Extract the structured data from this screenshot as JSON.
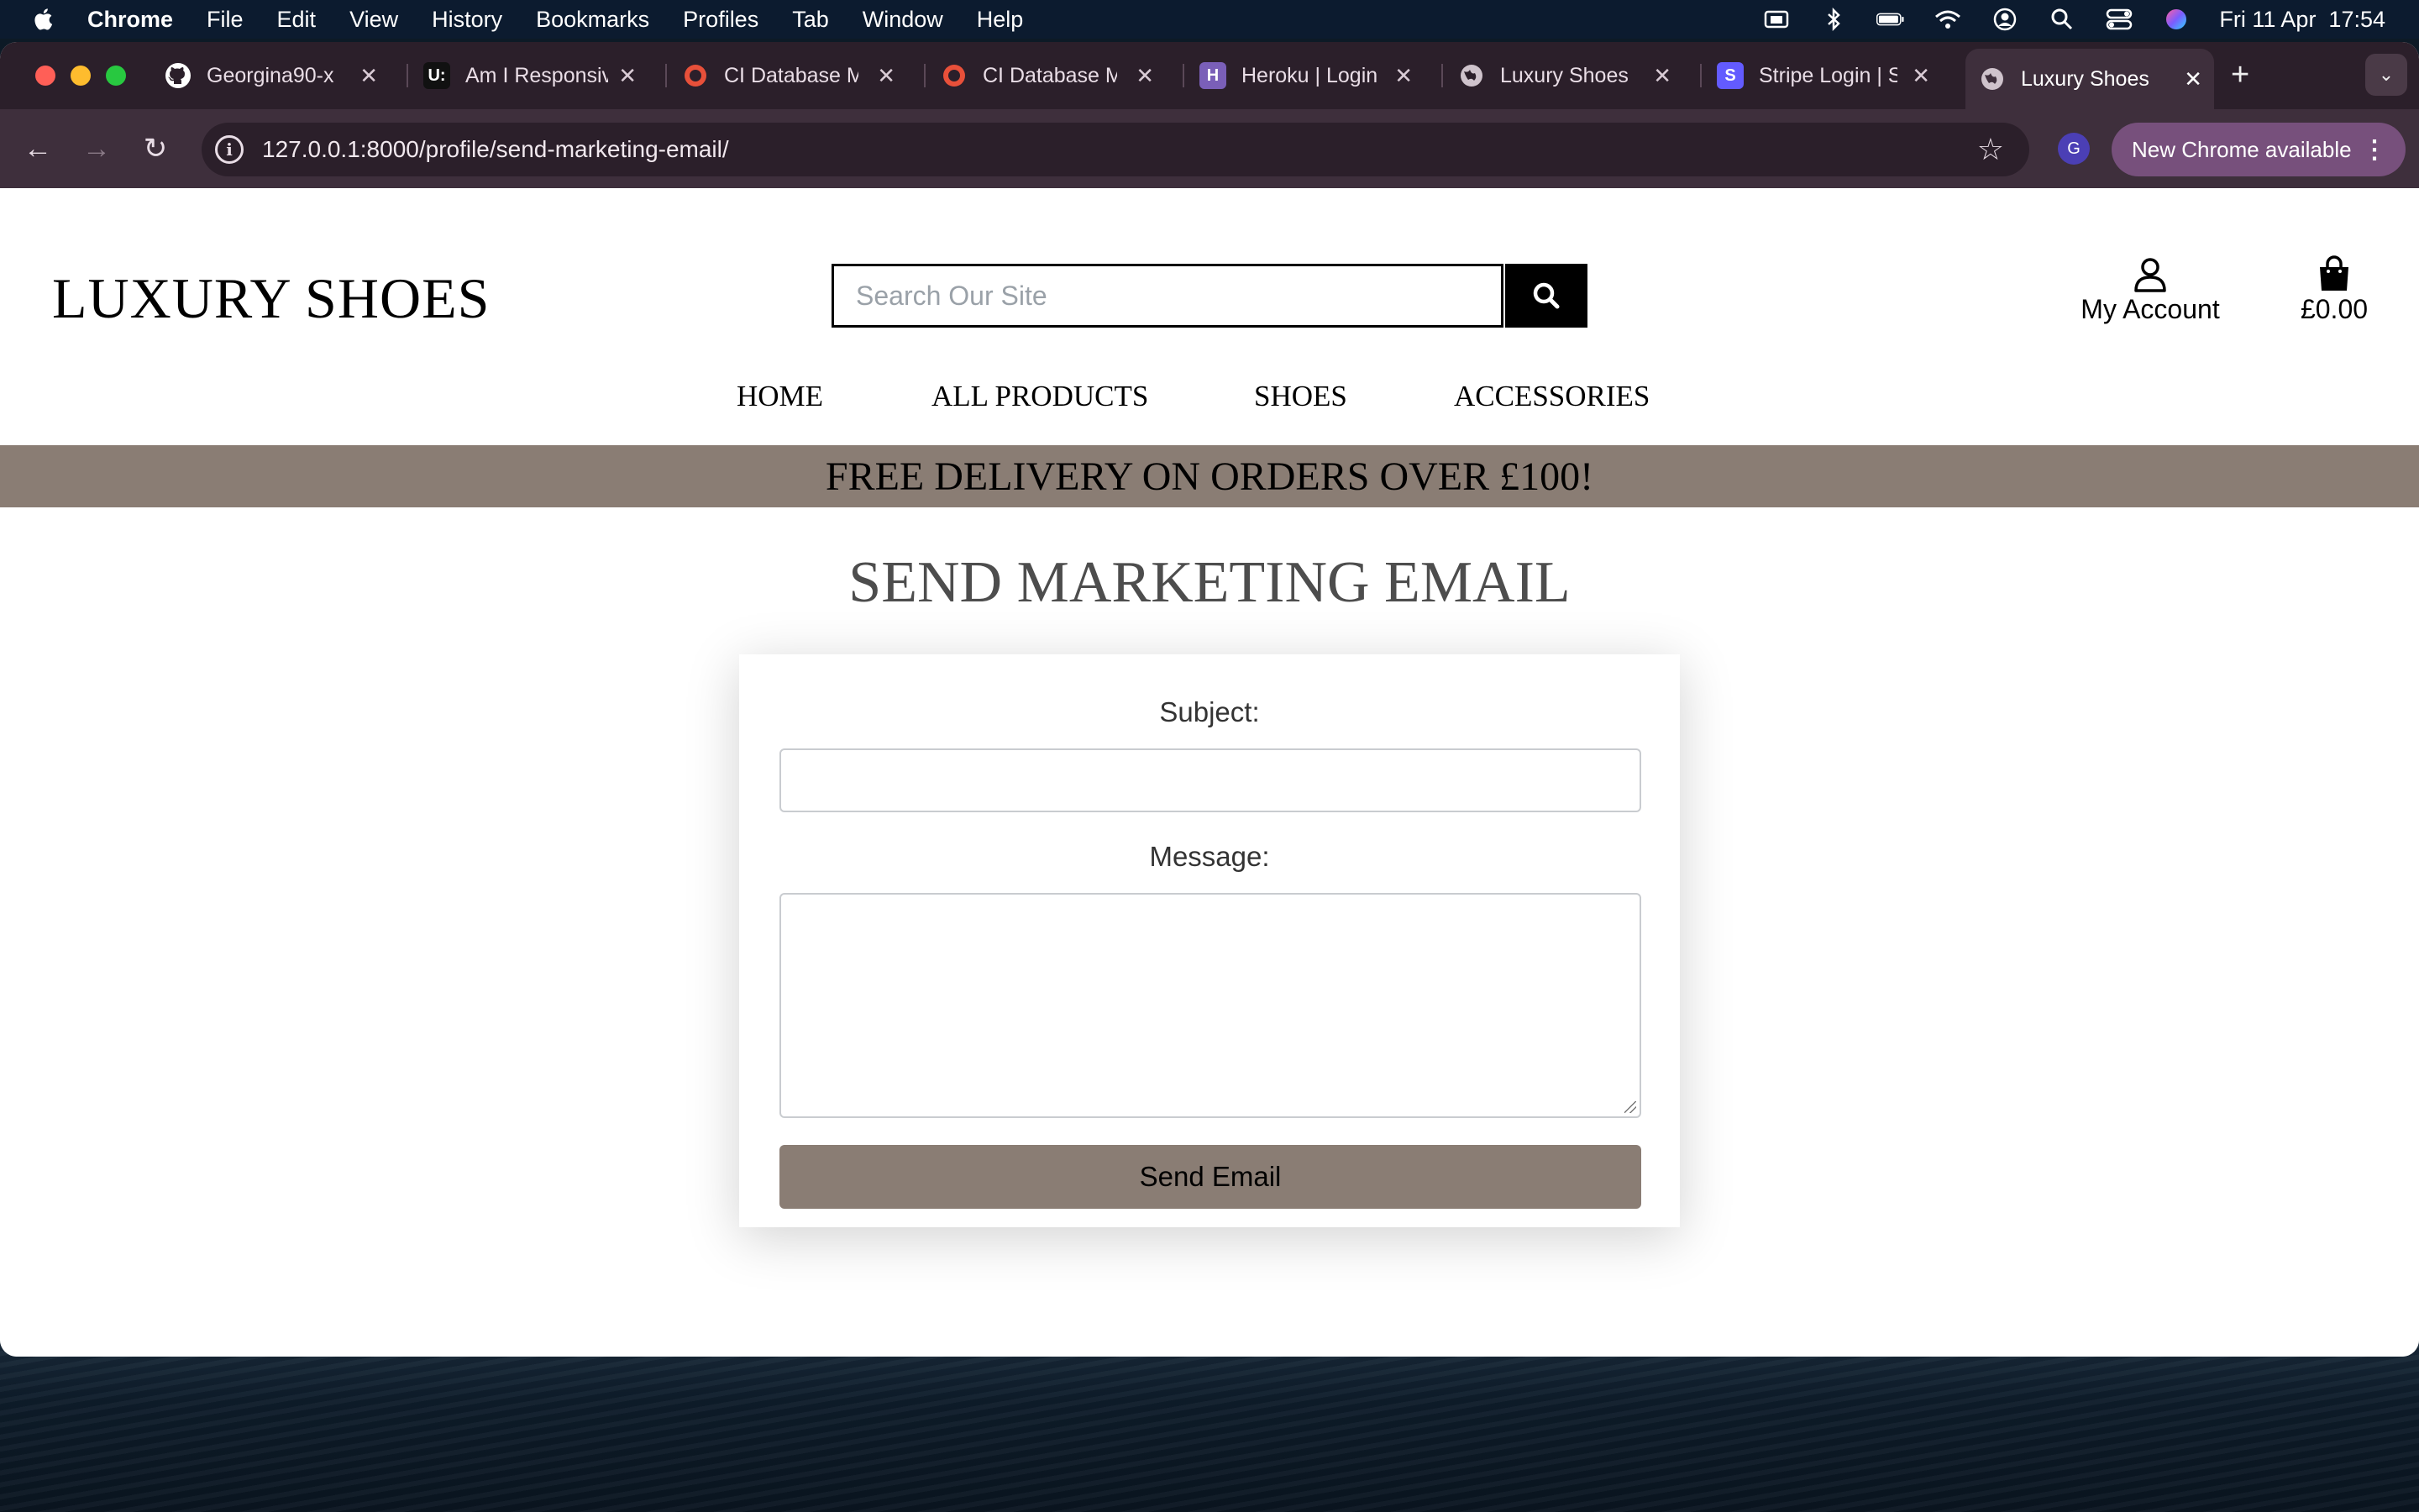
{
  "menubar": {
    "app_name": "Chrome",
    "items": [
      "File",
      "Edit",
      "View",
      "History",
      "Bookmarks",
      "Profiles",
      "Tab",
      "Window",
      "Help"
    ],
    "datetime": "Fri 11 Apr  17:54"
  },
  "tabs": [
    {
      "label": "Georgina90-x",
      "icon": "github-icon"
    },
    {
      "label": "Am I Responsive",
      "icon": "amiresponsive-icon"
    },
    {
      "label": "CI Database Maker",
      "icon": "ci-icon"
    },
    {
      "label": "CI Database Maker",
      "icon": "ci-icon"
    },
    {
      "label": "Heroku | Login",
      "icon": "heroku-icon"
    },
    {
      "label": "Luxury Shoes",
      "icon": "globe-icon"
    },
    {
      "label": "Stripe Login | Sign in",
      "icon": "stripe-icon"
    },
    {
      "label": "Luxury Shoes",
      "icon": "globe-icon",
      "active": true
    }
  ],
  "toolbar": {
    "url": "127.0.0.1:8000/profile/send-marketing-email/",
    "profile_initial": "G",
    "update_label": "New Chrome available"
  },
  "site": {
    "logo": "LUXURY SHOES",
    "search_placeholder": "Search Our Site",
    "account_label": "My Account",
    "bag_total": "£0.00",
    "nav": [
      "HOME",
      "ALL PRODUCTS",
      "SHOES",
      "ACCESSORIES"
    ],
    "banner": "FREE DELIVERY ON ORDERS OVER £100!"
  },
  "form": {
    "title": "SEND MARKETING EMAIL",
    "subject_label": "Subject:",
    "subject_value": "",
    "message_label": "Message:",
    "message_value": "",
    "submit_label": "Send Email"
  },
  "colors": {
    "brand_taupe": "#8a7d74",
    "menubar": "#0c1b2f",
    "tabstrip": "#2b1f2a",
    "toolbar": "#3e2f3c"
  }
}
